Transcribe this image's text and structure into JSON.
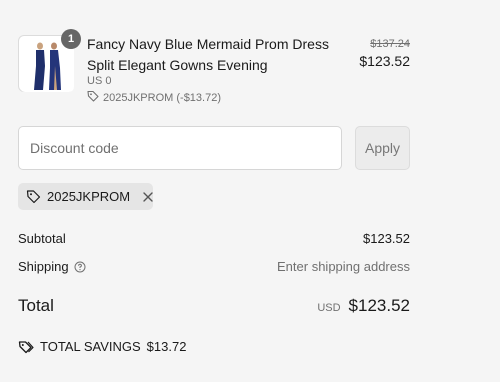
{
  "product": {
    "title": "Fancy Navy Blue Mermaid Prom Dress Split Elegant Gowns Evening",
    "quantity": "1",
    "variant": "US 0",
    "discount_line": "2025JKPROM (-$13.72)",
    "original_price": "$137.24",
    "price": "$123.52",
    "icon": "tag-icon"
  },
  "discount": {
    "placeholder": "Discount code",
    "value": "",
    "apply_label": "Apply",
    "applied_code": "2025JKPROM"
  },
  "summary": {
    "subtotal_label": "Subtotal",
    "subtotal_value": "$123.52",
    "shipping_label": "Shipping",
    "shipping_value": "Enter shipping address",
    "total_label": "Total",
    "currency": "USD",
    "total_value": "$123.52",
    "savings_label": "TOTAL SAVINGS",
    "savings_value": "$13.72"
  },
  "colors": {
    "background": "#f5f5f5",
    "text": "#1a1a1a",
    "muted": "#707070",
    "badge": "#666666",
    "chip": "#e5e5e5"
  }
}
